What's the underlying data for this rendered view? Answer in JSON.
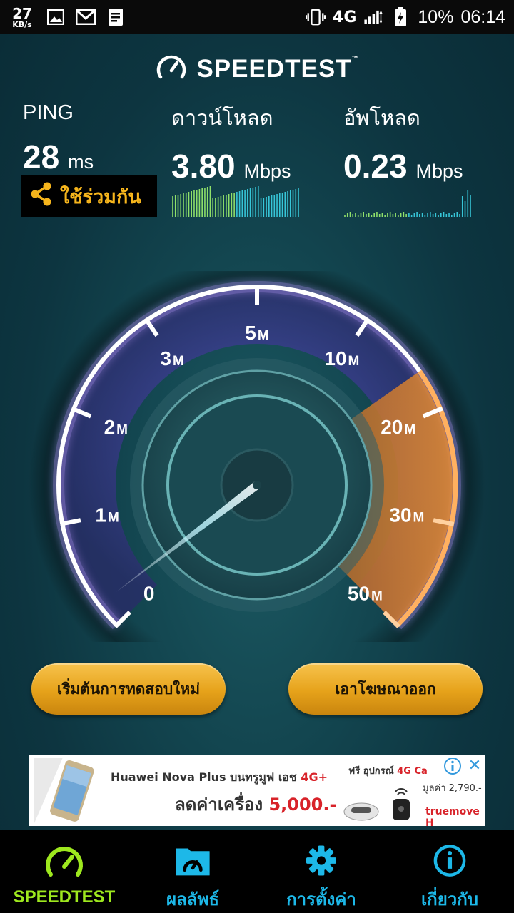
{
  "statusbar": {
    "net_speed": "27",
    "net_speed_unit": "KB/s",
    "network": "4G",
    "battery": "10%",
    "time": "06:14"
  },
  "app": {
    "title": "SPEEDTEST",
    "tm": "™"
  },
  "results": {
    "ping": {
      "label": "PING",
      "value": "28",
      "unit": "ms"
    },
    "download": {
      "label": "ดาวน์โหลด",
      "value": "3.80",
      "unit": "Mbps"
    },
    "upload": {
      "label": "อัพโหลด",
      "value": "0.23",
      "unit": "Mbps"
    },
    "share_label": "ใช้ร่วมกัน"
  },
  "gauge": {
    "scale_labels": [
      {
        "num": "0",
        "unit": ""
      },
      {
        "num": "1",
        "unit": "M"
      },
      {
        "num": "2",
        "unit": "M"
      },
      {
        "num": "3",
        "unit": "M"
      },
      {
        "num": "5",
        "unit": "M"
      },
      {
        "num": "10",
        "unit": "M"
      },
      {
        "num": "20",
        "unit": "M"
      },
      {
        "num": "30",
        "unit": "M"
      },
      {
        "num": "50",
        "unit": "M"
      }
    ],
    "needle_value": 0.23
  },
  "buttons": {
    "restart": "เริ่มต้นการทดสอบใหม่",
    "remove_ads": "เอาโฆษณาออก"
  },
  "ad": {
    "line1_prefix": "Huawei Nova Plus บนทรูมูฟ เอช ",
    "line1_accent": "4G+",
    "line2_prefix": "ลดค่าเครื่อง ",
    "line2_price": "5,000.-",
    "right_prefix": "ฟรี อุปกรณ์ ",
    "right_accent": "4G Ca",
    "right_price": "มูลค่า 2,790.-",
    "brand": "truemove H"
  },
  "tabs": [
    {
      "label": "SPEEDTEST",
      "icon": "speedometer-icon",
      "active": true
    },
    {
      "label": "ผลลัพธ์",
      "icon": "results-folder-icon",
      "active": false
    },
    {
      "label": "การตั้งค่า",
      "icon": "gear-icon",
      "active": false
    },
    {
      "label": "เกี่ยวกับ",
      "icon": "info-icon",
      "active": false
    }
  ],
  "colors": {
    "tab_active": "#9ee81e",
    "tab_inactive": "#1db8e8",
    "share_text": "#f6b51c",
    "button_gold": "#e6a21a"
  }
}
